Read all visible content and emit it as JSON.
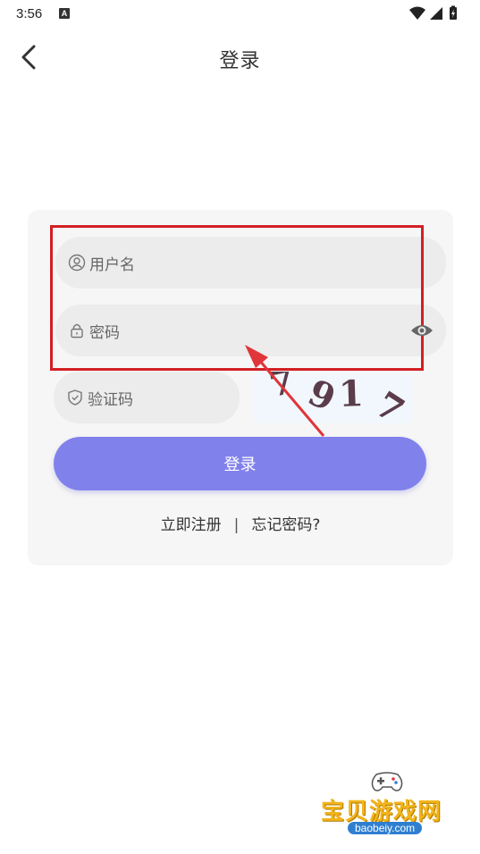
{
  "status_bar": {
    "time": "3:56",
    "notification_icon": "A"
  },
  "nav": {
    "title": "登录",
    "back_icon": "chevron-left-icon"
  },
  "form": {
    "username_placeholder": "用户名",
    "password_placeholder": "密码",
    "captcha_placeholder": "验证码",
    "captcha_code": "7917",
    "login_label": "登录"
  },
  "links": {
    "register": "立即注册",
    "separator": "|",
    "forgot": "忘记密码?"
  },
  "watermark": {
    "brand": "宝贝游戏网",
    "domain": "baobeiy.com"
  },
  "colors": {
    "primary_button": "#8181ec",
    "highlight": "#d21f24",
    "field_bg": "#ececec",
    "card_bg": "#f6f6f6"
  }
}
